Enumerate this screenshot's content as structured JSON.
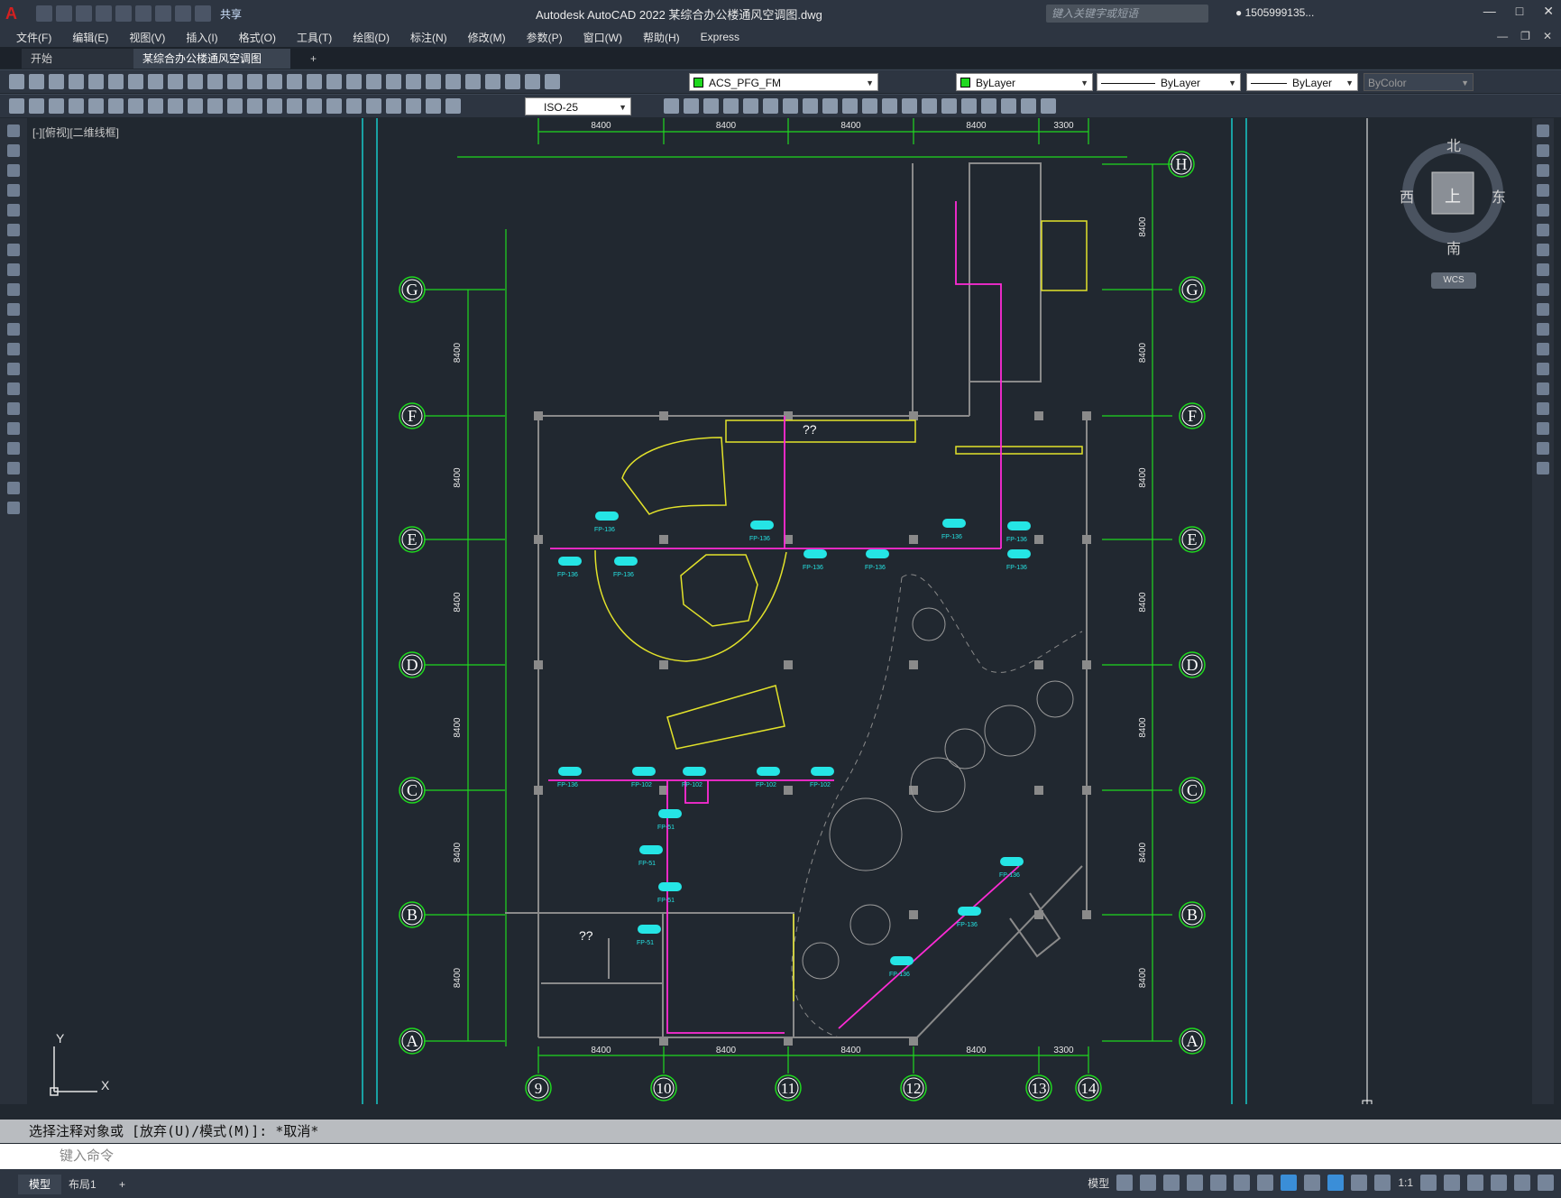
{
  "app": {
    "title": "Autodesk AutoCAD 2022    某综合办公楼通风空调图.dwg",
    "share_label": "共享",
    "search_placeholder": "键入关键字或短语",
    "user": "1505999135...",
    "logo_letter": "A"
  },
  "menu": {
    "items": [
      "文件(F)",
      "编辑(E)",
      "视图(V)",
      "插入(I)",
      "格式(O)",
      "工具(T)",
      "绘图(D)",
      "标注(N)",
      "修改(M)",
      "参数(P)",
      "窗口(W)",
      "帮助(H)",
      "Express"
    ]
  },
  "tabs": {
    "start": "开始",
    "doc": "某综合办公楼通风空调图*",
    "plus": "+"
  },
  "toolbar": {
    "layer": "ACS_PFG_FM",
    "color": "ByLayer",
    "linetype": "ByLayer",
    "lineweight": "ByLayer",
    "plotstyle": "ByColor",
    "dimstyle": "ISO-25"
  },
  "viewport": {
    "label": "[-][俯视][二维线框]"
  },
  "compass": {
    "north": "北",
    "south": "南",
    "east": "东",
    "west": "西",
    "top": "上",
    "wcs": "WCS"
  },
  "drawing": {
    "row_labels": [
      "H",
      "G",
      "F",
      "E",
      "D",
      "C",
      "B",
      "A"
    ],
    "col_labels": [
      "9",
      "10",
      "11",
      "12",
      "13",
      "14"
    ],
    "top_dims": [
      "8400",
      "8400",
      "8400",
      "8400",
      "3300"
    ],
    "bottom_dims": [
      "8400",
      "8400",
      "8400",
      "8400",
      "3300"
    ],
    "side_dims": [
      "8400",
      "8400",
      "8400",
      "8400",
      "8400",
      "8400",
      "8400"
    ],
    "unit_labels": [
      "FP-136",
      "FP-136",
      "FP-136",
      "FP-136",
      "FP-136",
      "FP-136",
      "FP-136",
      "FP-136",
      "FP-136",
      "FP-136",
      "FP-102",
      "FP-102",
      "FP-102",
      "FP-102",
      "FP-51",
      "FP-51",
      "FP-51",
      "FP-51",
      "FP-136",
      "FP-136",
      "FP-136"
    ],
    "room_marks": [
      "??",
      "??"
    ],
    "ucs_x": "X",
    "ucs_y": "Y"
  },
  "command": {
    "history": "选择注释对象或 [放弃(U)/模式(M)]: *取消*",
    "placeholder": "键入命令"
  },
  "status": {
    "model_tab": "模型",
    "layout_tab": "布局1",
    "plus": "+",
    "model_label": "模型",
    "scale": "1:1"
  },
  "colors": {
    "grid": "#1fd81f",
    "wall": "#8a8a8a",
    "pipe": "#ff2bd6",
    "unit": "#25e5e5",
    "stair": "#e2e22a",
    "frame": "#17c9c9"
  }
}
